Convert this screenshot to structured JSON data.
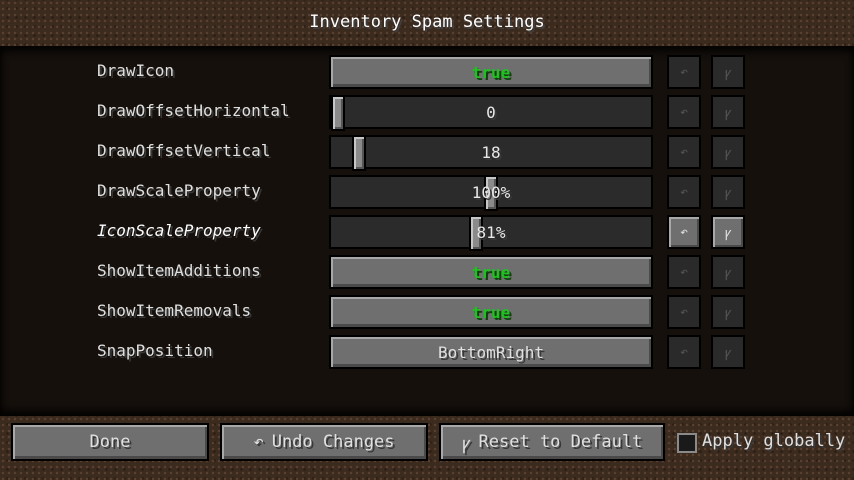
{
  "title": "Inventory Spam Settings",
  "rows": [
    {
      "label": "DrawIcon",
      "value": "true"
    },
    {
      "label": "DrawOffsetHorizontal",
      "value": "0",
      "slider_level": 0.0
    },
    {
      "label": "DrawOffsetVertical",
      "value": "18",
      "slider_level": 0.07
    },
    {
      "label": "DrawScaleProperty",
      "value": "100%",
      "slider_level": 0.5
    },
    {
      "label": "IconScaleProperty",
      "value": "81%",
      "slider_level": 0.45
    },
    {
      "label": "ShowItemAdditions",
      "value": "true"
    },
    {
      "label": "ShowItemRemovals",
      "value": "true"
    },
    {
      "label": "SnapPosition",
      "value": "BottomRight"
    }
  ],
  "row_icons": {
    "undo": "undo-arrow-icon",
    "reset": "broom-icon"
  },
  "footer": {
    "done_label": "Done",
    "undo_label": "Undo Changes",
    "reset_label": "Reset to Default",
    "apply_globally_label": "Apply globally"
  },
  "colors": {
    "true_value": "#20c020",
    "button": "#6f6f6f",
    "slider_bg": "#2b2b2b"
  }
}
